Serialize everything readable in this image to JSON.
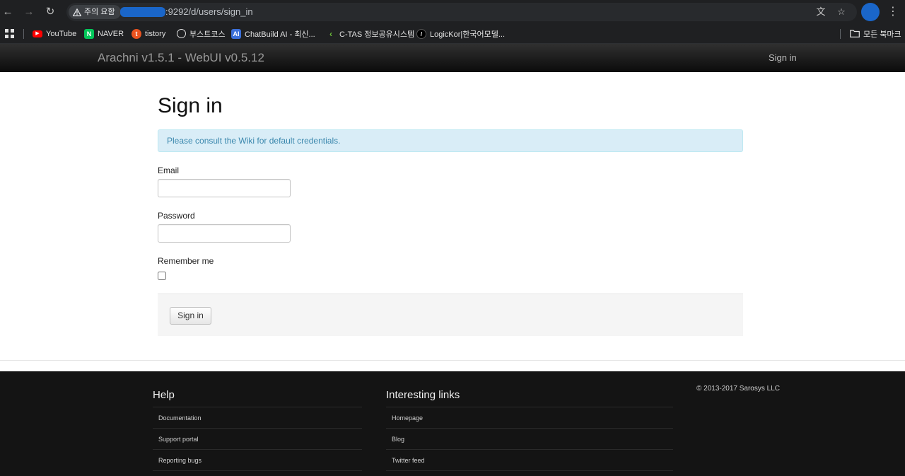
{
  "browser": {
    "security_chip": "주의 요함",
    "url": ":9292/d/users/sign_in",
    "bookmarks": [
      {
        "label": "YouTube",
        "icon": "youtube-icon",
        "color": "#ff0000"
      },
      {
        "label": "NAVER",
        "icon": "naver-icon",
        "color": "#03c75a"
      },
      {
        "label": "tistory",
        "icon": "tistory-icon",
        "color": "#eb531f"
      },
      {
        "label": "부스트코스",
        "icon": "globe-icon",
        "color": "#5f6368"
      },
      {
        "label": "ChatBuild AI - 최신...",
        "icon": "chatbuild-icon",
        "color": "#3b6fd8"
      },
      {
        "label": "C-TAS 정보공유시스템",
        "icon": "ctas-icon",
        "color": "#6dbf3a"
      },
      {
        "label": "LogicKor|한국어모델...",
        "icon": "logickor-icon",
        "color": "#000000"
      }
    ],
    "all_bookmarks": "모든 북마크"
  },
  "navbar": {
    "brand": "Arachni v1.5.1 - WebUI v0.5.12",
    "sign_in": "Sign in"
  },
  "main": {
    "title": "Sign in",
    "alert": "Please consult the Wiki for default credentials.",
    "email_label": "Email",
    "password_label": "Password",
    "remember_label": "Remember me",
    "submit_label": "Sign in"
  },
  "footer": {
    "help_title": "Help",
    "help_links": [
      "Documentation",
      "Support portal",
      "Reporting bugs"
    ],
    "links_title": "Interesting links",
    "interesting_links": [
      "Homepage",
      "Blog",
      "Twitter feed"
    ],
    "copyright": "© 2013-2017 Sarosys LLC"
  }
}
